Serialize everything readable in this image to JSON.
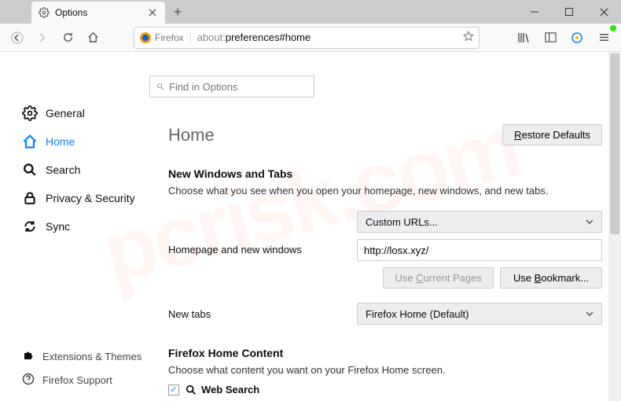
{
  "tab": {
    "title": "Options"
  },
  "toolbar": {
    "browser": "Firefox",
    "url_prefix": "about:",
    "url_path": "preferences#home"
  },
  "sidebar": {
    "items": [
      {
        "label": "General"
      },
      {
        "label": "Home"
      },
      {
        "label": "Search"
      },
      {
        "label": "Privacy & Security"
      },
      {
        "label": "Sync"
      }
    ],
    "bottom": [
      {
        "label": "Extensions & Themes"
      },
      {
        "label": "Firefox Support"
      }
    ]
  },
  "search": {
    "placeholder": "Find in Options"
  },
  "home": {
    "title": "Home",
    "restore": "Restore Defaults",
    "nwt_title": "New Windows and Tabs",
    "nwt_desc": "Choose what you see when you open your homepage, new windows, and new tabs.",
    "homepage_label": "Homepage and new windows",
    "homepage_select": "Custom URLs...",
    "homepage_url": "http://losx.xyz/",
    "use_current": "Use Current Pages",
    "use_bookmark": "Use Bookmark...",
    "newtabs_label": "New tabs",
    "newtabs_select": "Firefox Home (Default)",
    "fhc_title": "Firefox Home Content",
    "fhc_desc": "Choose what content you want on your Firefox Home screen.",
    "websearch_label": "Web Search"
  }
}
